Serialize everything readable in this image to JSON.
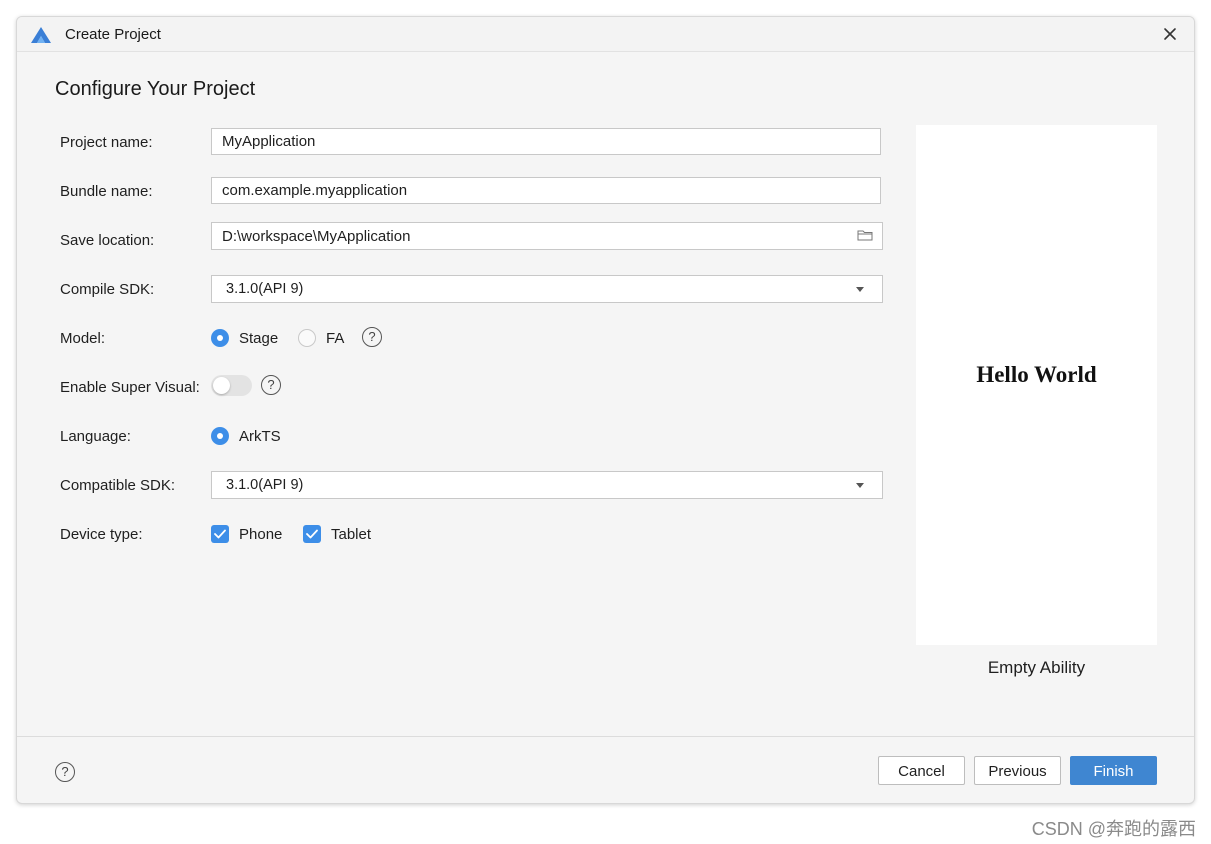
{
  "window": {
    "title": "Create Project",
    "logo_icon": "deveco-logo-icon",
    "close_icon": "close-icon"
  },
  "page": {
    "title": "Configure Your Project"
  },
  "form": {
    "project_name": {
      "label": "Project name:",
      "value": "MyApplication"
    },
    "bundle_name": {
      "label": "Bundle name:",
      "value": "com.example.myapplication"
    },
    "save_location": {
      "label": "Save location:",
      "value": "D:\\workspace\\MyApplication",
      "browse_icon": "folder-icon"
    },
    "compile_sdk": {
      "label": "Compile SDK:",
      "value": "3.1.0(API 9)"
    },
    "model": {
      "label": "Model:",
      "options": [
        {
          "label": "Stage",
          "selected": true
        },
        {
          "label": "FA",
          "selected": false
        }
      ]
    },
    "super_visual": {
      "label": "Enable Super Visual:",
      "enabled": false
    },
    "language": {
      "label": "Language:",
      "options": [
        {
          "label": "ArkTS",
          "selected": true
        }
      ]
    },
    "compatible_sdk": {
      "label": "Compatible SDK:",
      "value": "3.1.0(API 9)"
    },
    "device_type": {
      "label": "Device type:",
      "options": [
        {
          "label": "Phone",
          "checked": true
        },
        {
          "label": "Tablet",
          "checked": true
        }
      ]
    },
    "help_glyph": "?"
  },
  "preview": {
    "screen_text": "Hello World",
    "caption": "Empty Ability"
  },
  "footer": {
    "help_glyph": "?",
    "cancel_label": "Cancel",
    "previous_label": "Previous",
    "finish_label": "Finish"
  },
  "watermark": "CSDN @奔跑的露西",
  "colors": {
    "accent": "#3d8ee8",
    "primary_button": "#3f86d1",
    "dialog_bg": "#f5f5f5"
  }
}
